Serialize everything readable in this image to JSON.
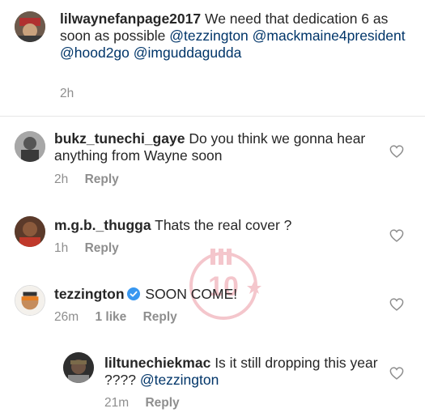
{
  "post_caption": {
    "username": "lilwaynefanpage2017",
    "text": "We need that dedication 6 as soon as possible",
    "mentions": [
      "@tezzington",
      "@mackmaine4president",
      "@hood2go",
      "@imguddagudda"
    ],
    "time": "2h"
  },
  "comments": [
    {
      "username": "bukz_tunechi_gaye",
      "text": "Do you think we gonna hear anything from Wayne soon",
      "time": "2h",
      "reply_label": "Reply"
    },
    {
      "username": "m.g.b._thugga",
      "text": "Thats the real cover ?",
      "time": "1h",
      "reply_label": "Reply"
    },
    {
      "username": "tezzington",
      "text": "SOON COME!",
      "time": "26m",
      "likes": "1 like",
      "reply_label": "Reply",
      "verified": true
    }
  ],
  "reply": {
    "username": "liltunechiekmac",
    "text": "Is it still dropping this year ????",
    "mention": "@tezzington",
    "time": "21m",
    "reply_label": "Reply"
  },
  "colors": {
    "text": "#262626",
    "meta": "#8e8e8e",
    "mention": "#003569",
    "verified": "#3897f0",
    "watermark": "#d0021b"
  },
  "icons": [
    "heart-icon",
    "verified-badge-icon"
  ]
}
